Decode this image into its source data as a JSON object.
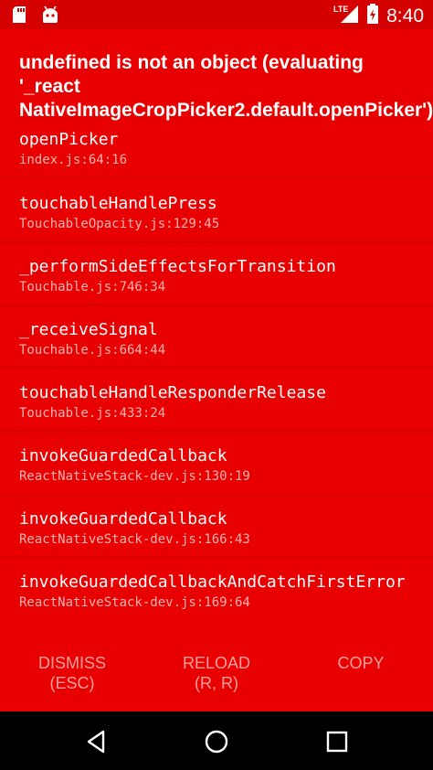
{
  "status_bar": {
    "time": "8:40",
    "network_label": "LTE",
    "icons": [
      "sd-card-icon",
      "android-debug-icon",
      "signal-icon",
      "battery-icon"
    ]
  },
  "error": {
    "title": "undefined is not an object (evaluating '_react NativeImageCropPicker2.default.openPicker')"
  },
  "stack": [
    {
      "name": "openPicker",
      "location": "index.js:64:16"
    },
    {
      "name": "touchableHandlePress",
      "location": "TouchableOpacity.js:129:45"
    },
    {
      "name": "_performSideEffectsForTransition",
      "location": "Touchable.js:746:34"
    },
    {
      "name": "_receiveSignal",
      "location": "Touchable.js:664:44"
    },
    {
      "name": "touchableHandleResponderRelease",
      "location": "Touchable.js:433:24"
    },
    {
      "name": "invokeGuardedCallback",
      "location": "ReactNativeStack-dev.js:130:19"
    },
    {
      "name": "invokeGuardedCallback",
      "location": "ReactNativeStack-dev.js:166:43"
    },
    {
      "name": "invokeGuardedCallbackAndCatchFirstError",
      "location": "ReactNativeStack-dev.js:169:64"
    }
  ],
  "buttons": {
    "dismiss": {
      "line1": "DISMISS",
      "line2": "(ESC)"
    },
    "reload": {
      "line1": "RELOAD",
      "line2": "(R, R)"
    },
    "copy": {
      "line1": "COPY"
    }
  },
  "colors": {
    "background": "#e80000",
    "status_bar": "#d40000",
    "button_text": "#ff9e9e",
    "nav_bar": "#000000"
  }
}
